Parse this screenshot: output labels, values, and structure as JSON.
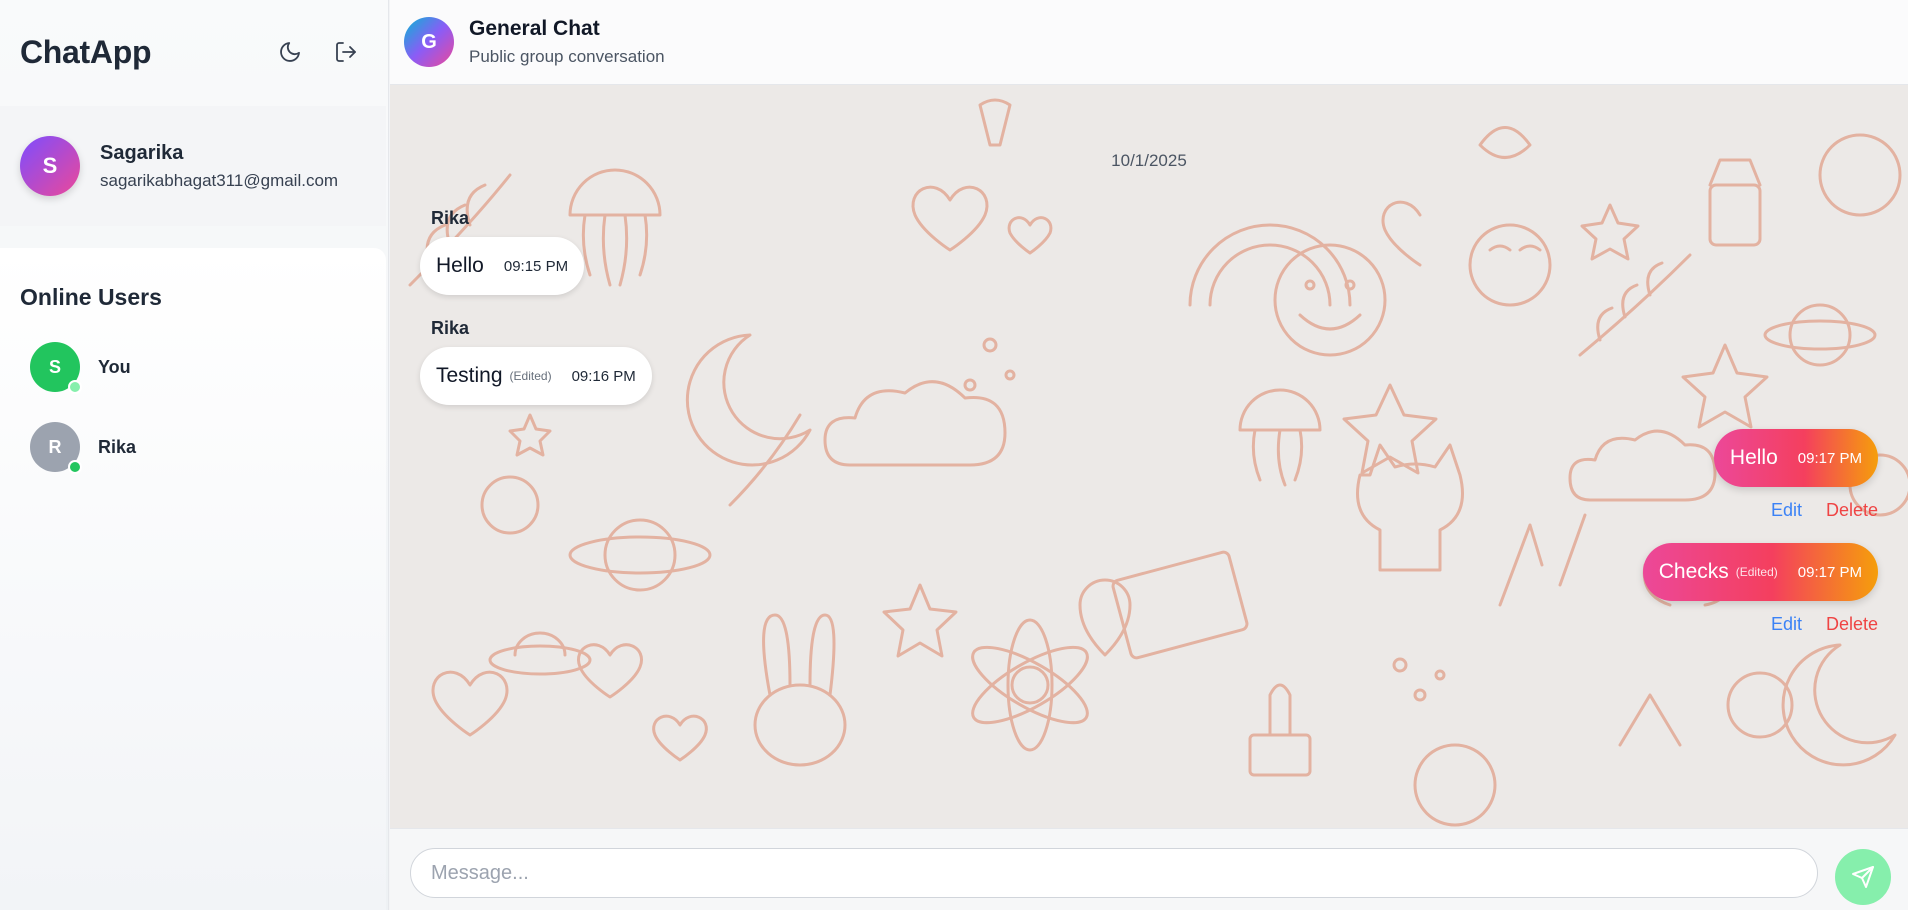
{
  "app": {
    "brand": "ChatApp"
  },
  "sidebar": {
    "theme_icon": "moon-icon",
    "logout_icon": "logout-icon",
    "profile": {
      "initial": "S",
      "name": "Sagarika",
      "email": "sagarikabhagat311@gmail.com"
    },
    "online_title": "Online Users",
    "users": [
      {
        "initial": "S",
        "name": "You",
        "status": "online"
      },
      {
        "initial": "R",
        "name": "Rika",
        "status": "online"
      }
    ]
  },
  "chat": {
    "avatar_initial": "G",
    "title": "General Chat",
    "subtitle": "Public group conversation",
    "date": "10/1/2025",
    "messages": [
      {
        "sender": "Rika",
        "text": "Hello",
        "edited": "",
        "time": "09:15 PM",
        "own": false
      },
      {
        "sender": "Rika",
        "text": "Testing",
        "edited": "(Edited)",
        "time": "09:16 PM",
        "own": false
      },
      {
        "sender": "",
        "text": "Hello",
        "edited": "",
        "time": "09:17 PM",
        "own": true,
        "edit_label": "Edit",
        "delete_label": "Delete"
      },
      {
        "sender": "",
        "text": "Checks",
        "edited": "(Edited)",
        "time": "09:17 PM",
        "own": true,
        "edit_label": "Edit",
        "delete_label": "Delete"
      }
    ]
  },
  "composer": {
    "placeholder": "Message...",
    "send_icon": "send-icon"
  },
  "colors": {
    "online_dot": "#22c55e",
    "edit_link": "#3b82f6",
    "delete_link": "#ef4444",
    "send_button": "#86efac",
    "doodle_stroke": "#e0a08a"
  }
}
